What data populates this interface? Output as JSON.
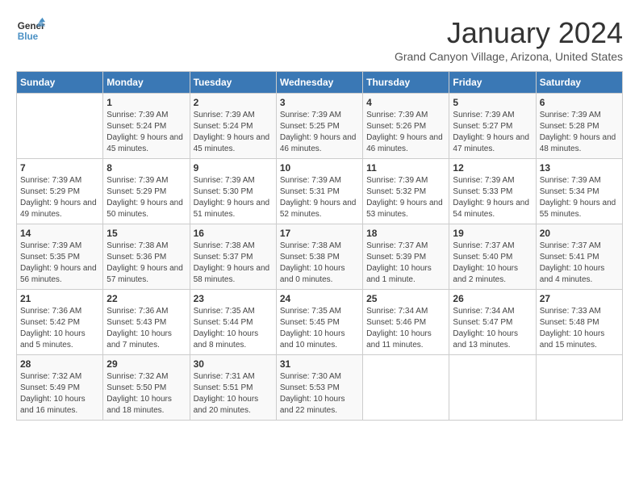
{
  "header": {
    "logo": "GeneralBlue",
    "title": "January 2024",
    "subtitle": "Grand Canyon Village, Arizona, United States"
  },
  "days_of_week": [
    "Sunday",
    "Monday",
    "Tuesday",
    "Wednesday",
    "Thursday",
    "Friday",
    "Saturday"
  ],
  "weeks": [
    [
      {
        "day": null,
        "data": null
      },
      {
        "day": "1",
        "data": "Sunrise: 7:39 AM\nSunset: 5:24 PM\nDaylight: 9 hours and 45 minutes."
      },
      {
        "day": "2",
        "data": "Sunrise: 7:39 AM\nSunset: 5:24 PM\nDaylight: 9 hours and 45 minutes."
      },
      {
        "day": "3",
        "data": "Sunrise: 7:39 AM\nSunset: 5:25 PM\nDaylight: 9 hours and 46 minutes."
      },
      {
        "day": "4",
        "data": "Sunrise: 7:39 AM\nSunset: 5:26 PM\nDaylight: 9 hours and 46 minutes."
      },
      {
        "day": "5",
        "data": "Sunrise: 7:39 AM\nSunset: 5:27 PM\nDaylight: 9 hours and 47 minutes."
      },
      {
        "day": "6",
        "data": "Sunrise: 7:39 AM\nSunset: 5:28 PM\nDaylight: 9 hours and 48 minutes."
      }
    ],
    [
      {
        "day": "7",
        "data": "Sunrise: 7:39 AM\nSunset: 5:29 PM\nDaylight: 9 hours and 49 minutes."
      },
      {
        "day": "8",
        "data": "Sunrise: 7:39 AM\nSunset: 5:29 PM\nDaylight: 9 hours and 50 minutes."
      },
      {
        "day": "9",
        "data": "Sunrise: 7:39 AM\nSunset: 5:30 PM\nDaylight: 9 hours and 51 minutes."
      },
      {
        "day": "10",
        "data": "Sunrise: 7:39 AM\nSunset: 5:31 PM\nDaylight: 9 hours and 52 minutes."
      },
      {
        "day": "11",
        "data": "Sunrise: 7:39 AM\nSunset: 5:32 PM\nDaylight: 9 hours and 53 minutes."
      },
      {
        "day": "12",
        "data": "Sunrise: 7:39 AM\nSunset: 5:33 PM\nDaylight: 9 hours and 54 minutes."
      },
      {
        "day": "13",
        "data": "Sunrise: 7:39 AM\nSunset: 5:34 PM\nDaylight: 9 hours and 55 minutes."
      }
    ],
    [
      {
        "day": "14",
        "data": "Sunrise: 7:39 AM\nSunset: 5:35 PM\nDaylight: 9 hours and 56 minutes."
      },
      {
        "day": "15",
        "data": "Sunrise: 7:38 AM\nSunset: 5:36 PM\nDaylight: 9 hours and 57 minutes."
      },
      {
        "day": "16",
        "data": "Sunrise: 7:38 AM\nSunset: 5:37 PM\nDaylight: 9 hours and 58 minutes."
      },
      {
        "day": "17",
        "data": "Sunrise: 7:38 AM\nSunset: 5:38 PM\nDaylight: 10 hours and 0 minutes."
      },
      {
        "day": "18",
        "data": "Sunrise: 7:37 AM\nSunset: 5:39 PM\nDaylight: 10 hours and 1 minute."
      },
      {
        "day": "19",
        "data": "Sunrise: 7:37 AM\nSunset: 5:40 PM\nDaylight: 10 hours and 2 minutes."
      },
      {
        "day": "20",
        "data": "Sunrise: 7:37 AM\nSunset: 5:41 PM\nDaylight: 10 hours and 4 minutes."
      }
    ],
    [
      {
        "day": "21",
        "data": "Sunrise: 7:36 AM\nSunset: 5:42 PM\nDaylight: 10 hours and 5 minutes."
      },
      {
        "day": "22",
        "data": "Sunrise: 7:36 AM\nSunset: 5:43 PM\nDaylight: 10 hours and 7 minutes."
      },
      {
        "day": "23",
        "data": "Sunrise: 7:35 AM\nSunset: 5:44 PM\nDaylight: 10 hours and 8 minutes."
      },
      {
        "day": "24",
        "data": "Sunrise: 7:35 AM\nSunset: 5:45 PM\nDaylight: 10 hours and 10 minutes."
      },
      {
        "day": "25",
        "data": "Sunrise: 7:34 AM\nSunset: 5:46 PM\nDaylight: 10 hours and 11 minutes."
      },
      {
        "day": "26",
        "data": "Sunrise: 7:34 AM\nSunset: 5:47 PM\nDaylight: 10 hours and 13 minutes."
      },
      {
        "day": "27",
        "data": "Sunrise: 7:33 AM\nSunset: 5:48 PM\nDaylight: 10 hours and 15 minutes."
      }
    ],
    [
      {
        "day": "28",
        "data": "Sunrise: 7:32 AM\nSunset: 5:49 PM\nDaylight: 10 hours and 16 minutes."
      },
      {
        "day": "29",
        "data": "Sunrise: 7:32 AM\nSunset: 5:50 PM\nDaylight: 10 hours and 18 minutes."
      },
      {
        "day": "30",
        "data": "Sunrise: 7:31 AM\nSunset: 5:51 PM\nDaylight: 10 hours and 20 minutes."
      },
      {
        "day": "31",
        "data": "Sunrise: 7:30 AM\nSunset: 5:53 PM\nDaylight: 10 hours and 22 minutes."
      },
      {
        "day": null,
        "data": null
      },
      {
        "day": null,
        "data": null
      },
      {
        "day": null,
        "data": null
      }
    ]
  ]
}
